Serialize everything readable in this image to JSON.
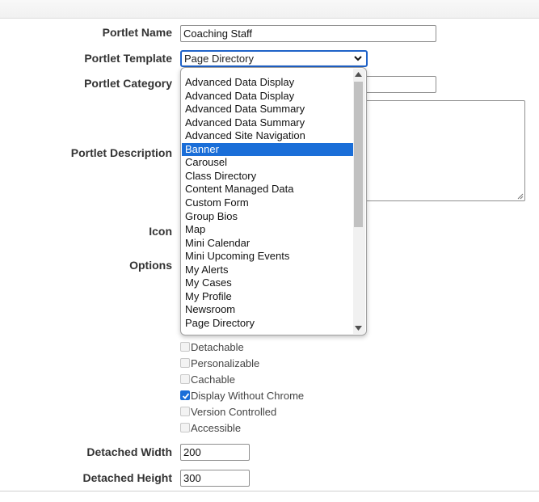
{
  "form": {
    "portlet_name_label": "Portlet Name",
    "portlet_name_value": "Coaching Staff",
    "portlet_template_label": "Portlet Template",
    "portlet_template_value": "Page Directory",
    "portlet_category_label": "Portlet Category",
    "portlet_description_label": "Portlet Description",
    "icon_label": "Icon",
    "options_label": "Options",
    "detached_width_label": "Detached Width",
    "detached_width_value": "200",
    "detached_height_label": "Detached Height",
    "detached_height_value": "300"
  },
  "template_options": [
    "",
    "Advanced Data Display",
    "Advanced Data Display",
    "Advanced Data Summary",
    "Advanced Data Summary",
    "Advanced Site Navigation",
    "Banner",
    "Carousel",
    "Class Directory",
    "Content Managed Data",
    "Custom Form",
    "Group Bios",
    "Map",
    "Mini Calendar",
    "Mini Upcoming Events",
    "My Alerts",
    "My Cases",
    "My Profile",
    "Newsroom",
    "Page Directory"
  ],
  "highlighted_option": "Banner",
  "options": [
    {
      "label": "Detachable",
      "checked": false
    },
    {
      "label": "Personalizable",
      "checked": false
    },
    {
      "label": "Cachable",
      "checked": false
    },
    {
      "label": "Display Without Chrome",
      "checked": true
    },
    {
      "label": "Version Controlled",
      "checked": false
    },
    {
      "label": "Accessible",
      "checked": false
    }
  ],
  "colors": {
    "accent": "#1a6ed8",
    "focus_border": "#1f62c8"
  },
  "icons": [
    "chevron-down-icon",
    "scroll-up-arrow-icon",
    "scroll-down-arrow-icon",
    "checkmark-icon",
    "resize-grip-icon"
  ]
}
